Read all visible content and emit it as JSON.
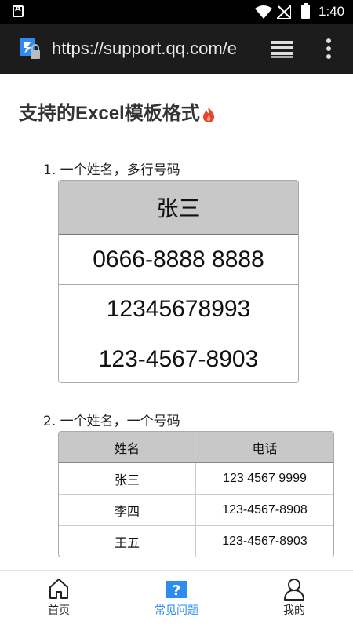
{
  "status_bar": {
    "time": "1:40",
    "icons": [
      "app-notification-icon",
      "wifi-icon",
      "signal-off-icon",
      "battery-icon"
    ]
  },
  "browser": {
    "url": "https://support.qq.com/e",
    "icons": [
      "site-lock-icon",
      "tabs-icon",
      "overflow-menu-icon"
    ]
  },
  "page": {
    "title": "支持的Excel模板格式",
    "title_icon": "fire-icon",
    "section1": {
      "label": "1. 一个姓名，多行号码",
      "header": "张三",
      "rows": [
        "0666-8888 8888",
        "12345678993",
        "123-4567-8903"
      ]
    },
    "section2": {
      "label": "2. 一个姓名，一个号码",
      "headers": {
        "name": "姓名",
        "phone": "电话"
      },
      "rows": [
        {
          "name": "张三",
          "phone": "123 4567 9999"
        },
        {
          "name": "李四",
          "phone": "123-4567-8908"
        },
        {
          "name": "王五",
          "phone": "123-4567-8903"
        }
      ]
    }
  },
  "bottom_nav": {
    "items": [
      {
        "label": "首页",
        "icon": "home-icon",
        "active": false
      },
      {
        "label": "常见问题",
        "icon": "question-icon",
        "active": true
      },
      {
        "label": "我的",
        "icon": "user-icon",
        "active": false
      }
    ],
    "colors": {
      "active": "#2d8cf0",
      "inactive": "#222222"
    }
  }
}
